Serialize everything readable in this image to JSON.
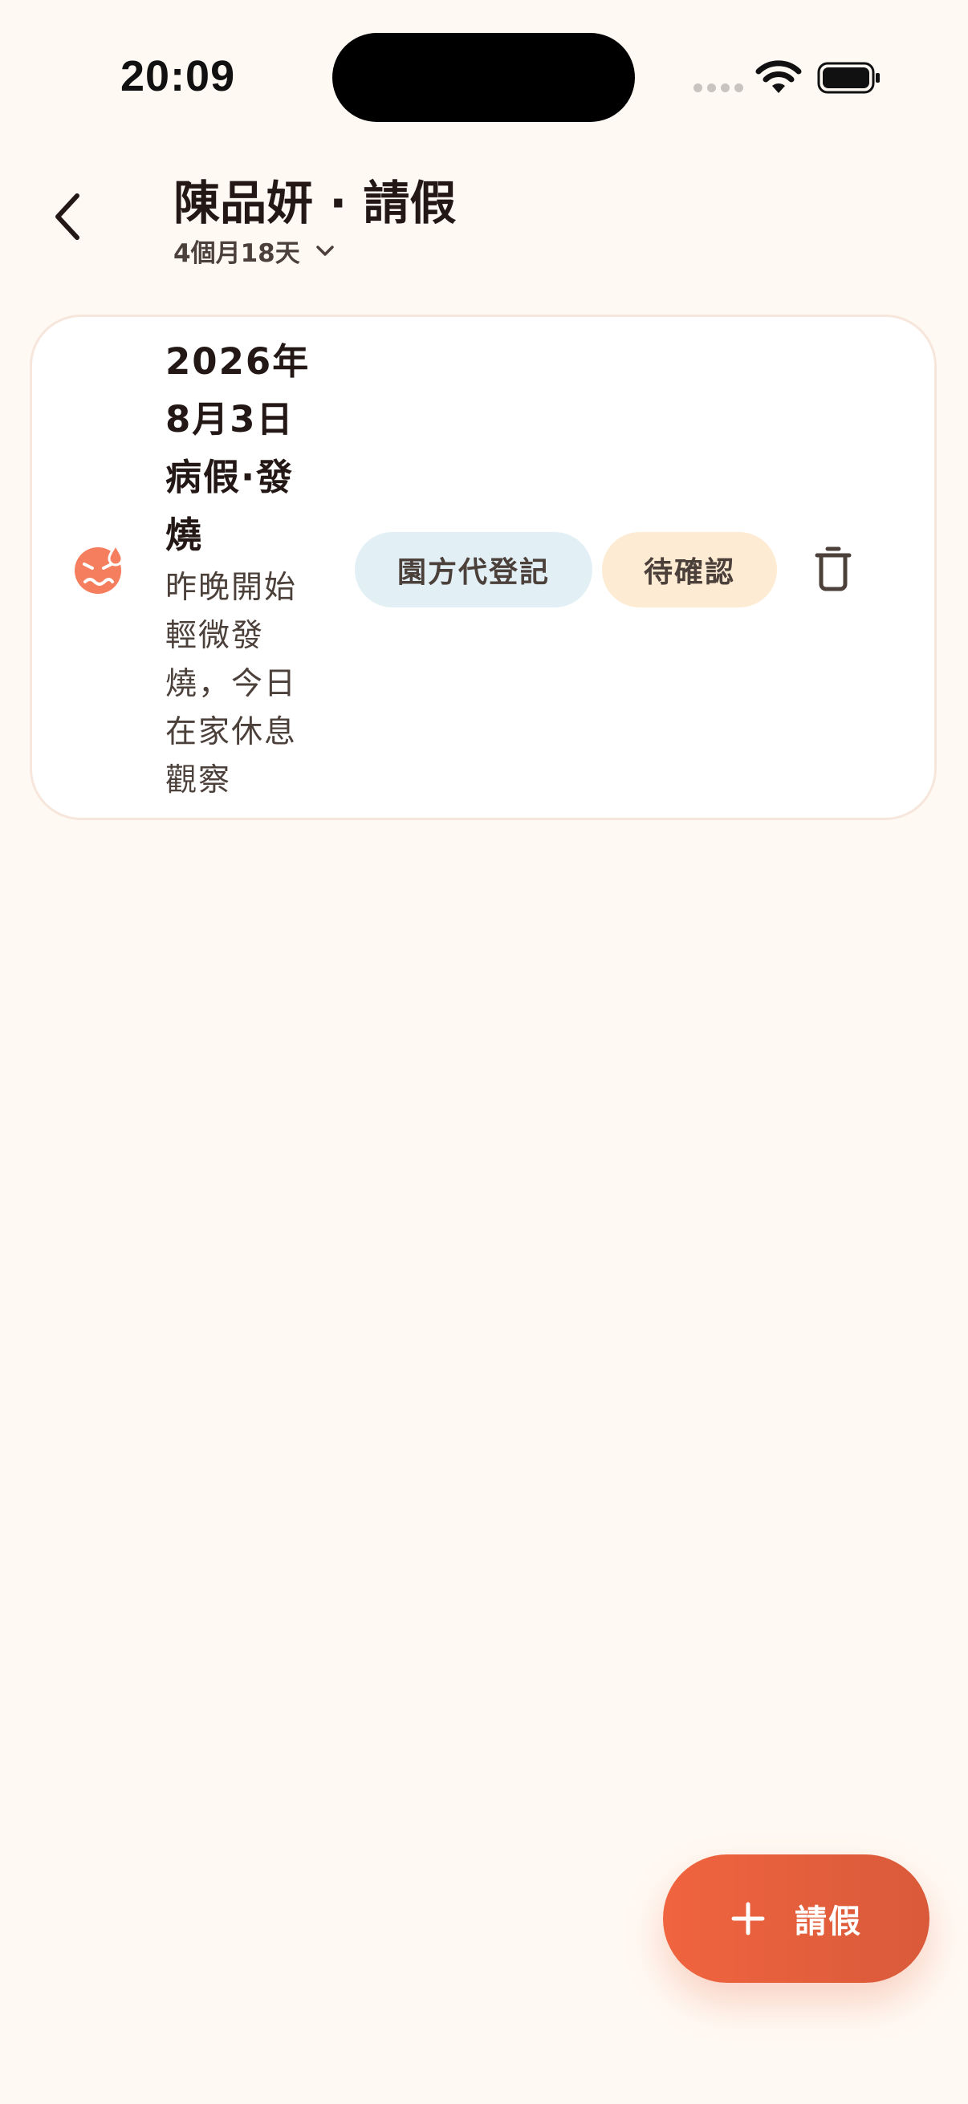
{
  "status_bar": {
    "time": "20:09"
  },
  "header": {
    "title": "陳品妍 · 請假",
    "age_label": "4個月18天",
    "back_icon": "chevron-left-icon",
    "age_dropdown_icon": "chevron-down-icon"
  },
  "leave_records": [
    {
      "date": "2026年8月3日",
      "type": "病假·發燒",
      "note": "昨晚開始輕微發燒，今日在家休息觀察",
      "icon": "sick-face-icon",
      "registrar_chip": "園方代登記",
      "status_chip": "待確認",
      "delete_icon": "trash-icon"
    }
  ],
  "fab": {
    "label": "請假",
    "icon": "plus-icon"
  },
  "colors": {
    "background": "#FFF9F3",
    "accent": "#F0643F",
    "registrar_chip_bg": "#E2F0F6",
    "status_chip_bg": "#FDEBD3",
    "sick_icon": "#F47E5E"
  }
}
